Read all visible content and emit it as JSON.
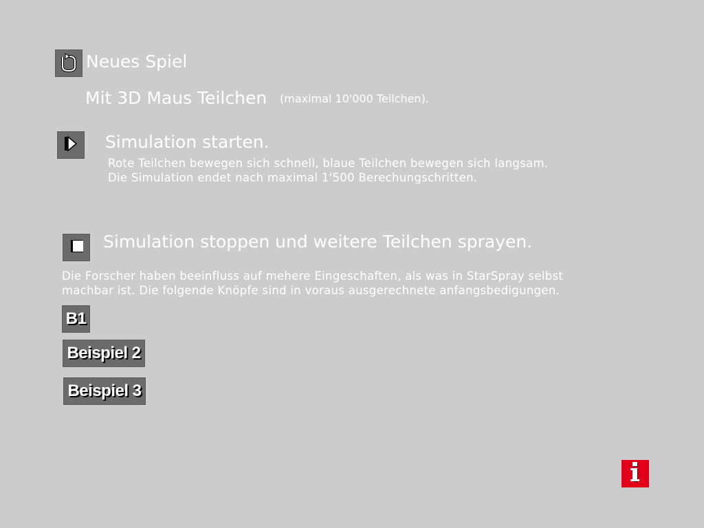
{
  "new_game": {
    "icon": "restart-icon",
    "label": "Neues Spiel"
  },
  "mouse_mode": {
    "label": "Mit 3D Maus Teilchen",
    "note": "(maximal 10'000 Teilchen)."
  },
  "start": {
    "icon": "play-icon",
    "title": "Simulation starten.",
    "line1": "Rote Teilchen bewegen sich schnell, blaue Teilchen bewegen sich langsam.",
    "line2": "Die Simulation endet nach maximal 1'500 Berechungschritten."
  },
  "stop": {
    "icon": "stop-icon",
    "title": "Simulation stoppen und weitere Teilchen sprayen.",
    "line1": "Die Forscher haben beeinfluss auf mehere Eingeschaften, als was in StarSpray selbst",
    "line2": "machbar ist. Die folgende Knöpfe sind in voraus ausgerechnete anfangsbedigungen."
  },
  "examples": [
    {
      "label": "B1"
    },
    {
      "label": "Beispiel 2"
    },
    {
      "label": "Beispiel 3"
    }
  ],
  "info": {
    "icon": "info-icon"
  },
  "colors": {
    "background": "#cccccc",
    "button": "#6b6b6b",
    "info_red": "#e2001a",
    "text": "#ffffff"
  }
}
